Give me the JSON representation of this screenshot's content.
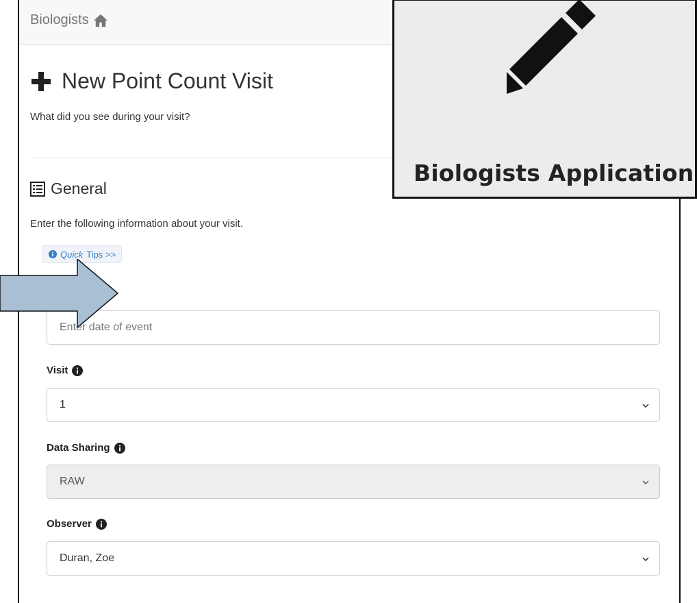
{
  "navbar": {
    "brand": "Biologists"
  },
  "page": {
    "title": "New Point Count Visit",
    "subtitle": "What did you see during your visit?"
  },
  "section": {
    "title": "General",
    "description": "Enter the following information about your visit.",
    "tips_prefix": "Quick",
    "tips_suffix": "Tips >>"
  },
  "fields": {
    "date": {
      "placeholder": "Enter date of event"
    },
    "visit": {
      "label": "Visit",
      "value": "1"
    },
    "data_sharing": {
      "label": "Data Sharing",
      "value": "RAW"
    },
    "observer": {
      "label": "Observer",
      "value": "Duran, Zoe"
    }
  },
  "overlay": {
    "app_name": "Biologists Application",
    "icon": "pencil-icon"
  },
  "colors": {
    "accent_link": "#3a7bc8",
    "arrow_fill": "#a9bfd3",
    "overlay_bg": "#ececec"
  }
}
